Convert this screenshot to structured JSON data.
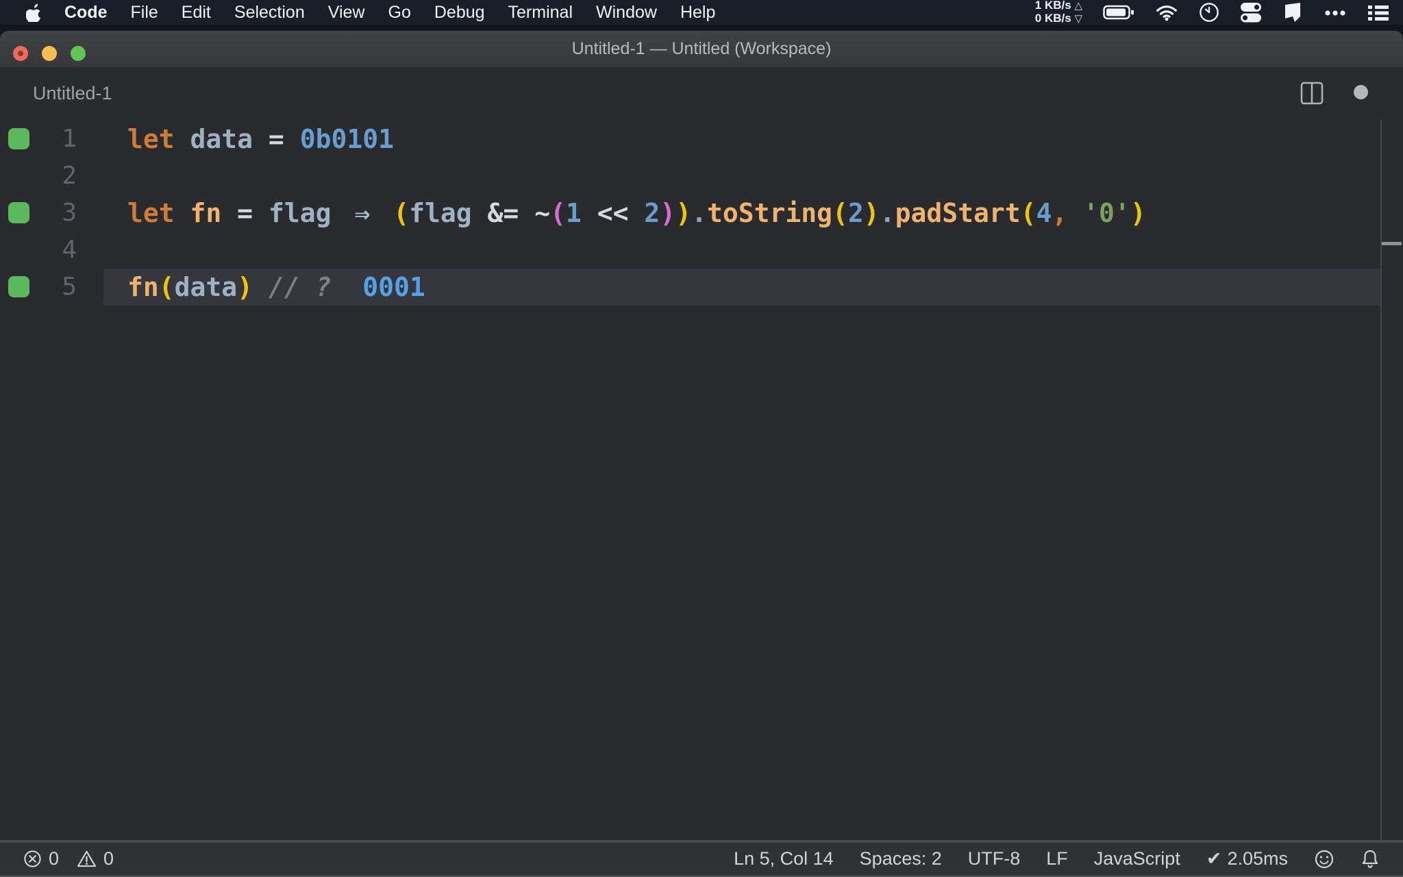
{
  "menu_bar": {
    "items": [
      "Code",
      "File",
      "Edit",
      "Selection",
      "View",
      "Go",
      "Debug",
      "Terminal",
      "Window",
      "Help"
    ],
    "network": {
      "up": "1 KB/s",
      "up_arrow": "△",
      "down": "0 KB/s",
      "down_arrow": "▽"
    }
  },
  "title_bar": {
    "title": "Untitled-1 — Untitled (Workspace)"
  },
  "tab_bar": {
    "tab_label": "Untitled-1"
  },
  "editor": {
    "lines": [
      {
        "number": "1",
        "coverage": true,
        "current": false,
        "tokens": [
          {
            "c": "kw",
            "t": "let "
          },
          {
            "c": "var",
            "t": "data"
          },
          {
            "c": "plain",
            "t": " "
          },
          {
            "c": "op",
            "t": "="
          },
          {
            "c": "plain",
            "t": " "
          },
          {
            "c": "num",
            "t": "0b0101"
          }
        ]
      },
      {
        "number": "2",
        "coverage": false,
        "current": false,
        "tokens": []
      },
      {
        "number": "3",
        "coverage": true,
        "current": false,
        "tokens": [
          {
            "c": "kw",
            "t": "let "
          },
          {
            "c": "fname",
            "t": "fn"
          },
          {
            "c": "plain",
            "t": " "
          },
          {
            "c": "op",
            "t": "="
          },
          {
            "c": "plain",
            "t": " "
          },
          {
            "c": "var",
            "t": "flag"
          },
          {
            "c": "plain",
            "t": " "
          },
          {
            "c": "arrow",
            "t": "⇒"
          },
          {
            "c": "plain",
            "t": " "
          },
          {
            "c": "b1",
            "t": "("
          },
          {
            "c": "var",
            "t": "flag"
          },
          {
            "c": "plain",
            "t": " "
          },
          {
            "c": "op",
            "t": "&="
          },
          {
            "c": "plain",
            "t": " "
          },
          {
            "c": "op",
            "t": "~"
          },
          {
            "c": "b2",
            "t": "("
          },
          {
            "c": "num",
            "t": "1"
          },
          {
            "c": "plain",
            "t": " "
          },
          {
            "c": "op",
            "t": "<<"
          },
          {
            "c": "plain",
            "t": " "
          },
          {
            "c": "num",
            "t": "2"
          },
          {
            "c": "b2",
            "t": ")"
          },
          {
            "c": "b1",
            "t": ")"
          },
          {
            "c": "dot",
            "t": "."
          },
          {
            "c": "fname",
            "t": "toString"
          },
          {
            "c": "b1",
            "t": "("
          },
          {
            "c": "num",
            "t": "2"
          },
          {
            "c": "b1",
            "t": ")"
          },
          {
            "c": "dot",
            "t": "."
          },
          {
            "c": "fname",
            "t": "padStart"
          },
          {
            "c": "b1",
            "t": "("
          },
          {
            "c": "num",
            "t": "4"
          },
          {
            "c": "comma",
            "t": ","
          },
          {
            "c": "plain",
            "t": " "
          },
          {
            "c": "str",
            "t": "'0'"
          },
          {
            "c": "b1",
            "t": ")"
          }
        ]
      },
      {
        "number": "4",
        "coverage": false,
        "current": false,
        "tokens": []
      },
      {
        "number": "5",
        "coverage": true,
        "current": true,
        "tokens": [
          {
            "c": "fname",
            "t": "fn"
          },
          {
            "c": "b1",
            "t": "("
          },
          {
            "c": "var",
            "t": "data"
          },
          {
            "c": "b1",
            "t": ")"
          },
          {
            "c": "plain",
            "t": " "
          },
          {
            "c": "comment",
            "t": "// ?"
          },
          {
            "c": "plain",
            "t": "  "
          },
          {
            "c": "quokka",
            "t": "0001"
          }
        ]
      }
    ]
  },
  "status_bar": {
    "errors": "0",
    "warnings": "0",
    "cursor_position": "Ln 5, Col 14",
    "indentation": "Spaces: 2",
    "encoding": "UTF-8",
    "eol": "LF",
    "language": "JavaScript",
    "check_icon": "✔",
    "perf_time": "2.05ms"
  },
  "colors": {
    "menubar_bg": "#1a1e29",
    "titlebar_bg": "#3b3c3e",
    "editor_bg": "#2a2b2e",
    "statusbar_bg": "#313235",
    "coverage_green": "#5cb85c",
    "keyword_orange": "#cd7c39",
    "function_peach": "#efb36e",
    "number_blue": "#689dce",
    "quokka_value_blue": "#53a1e6",
    "string_green": "#7ba05f",
    "bracket_yellow": "#eec50a",
    "bracket_pink": "#d36fd3",
    "traffic_red": "#ee6a5f",
    "traffic_yellow": "#f5bf4f",
    "traffic_green": "#61c554"
  }
}
